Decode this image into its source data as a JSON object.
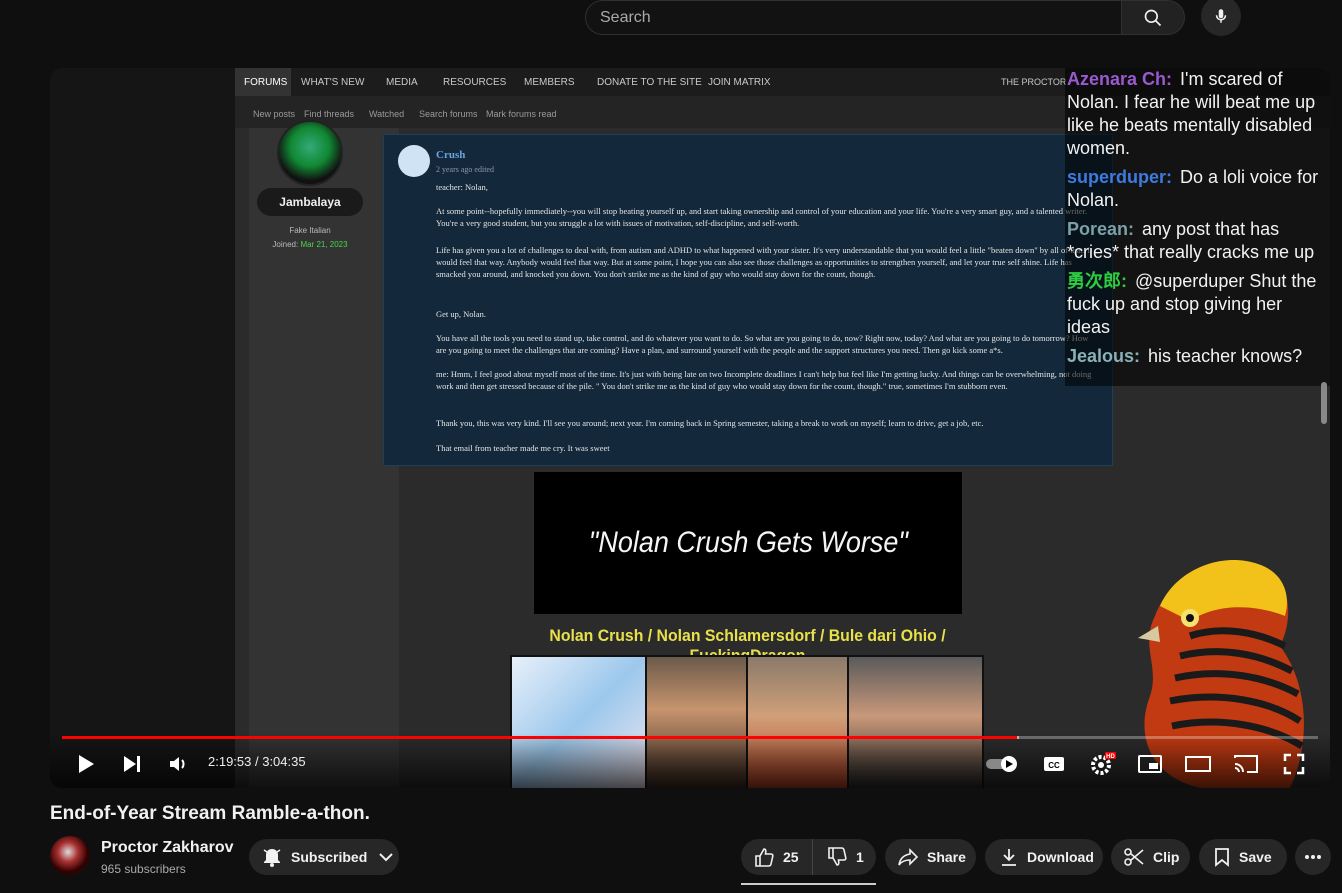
{
  "search": {
    "placeholder": "Search"
  },
  "forum": {
    "nav": [
      "FORUMS",
      "WHAT'S NEW",
      "MEDIA",
      "RESOURCES",
      "MEMBERS",
      "DONATE TO THE SITE",
      "JOIN MATRIX"
    ],
    "user_link": "THE PROCTOR",
    "subnav": [
      "New posts",
      "Find threads",
      "Watched",
      "Search forums",
      "Mark forums read"
    ],
    "sidebar": {
      "name": "Jambalaya",
      "title": "Fake Italian",
      "joined_label": "Joined:",
      "joined_date": "Mar 21, 2023"
    },
    "post": {
      "author": "Crush",
      "meta": "2 years ago     edited",
      "paragraphs": [
        "teacher: Nolan,",
        "At some point--hopefully immediately--you will stop beating yourself up, and start taking ownership and control of your education and your life. You're a very smart guy, and a talented writer. You're a very good student, but you struggle a lot with issues of motivation, self-discipline, and self-worth.",
        "Life has given you a lot of challenges to deal with, from autism and ADHD to what happened with your sister. It's very understandable that you would feel a little \"beaten down\" by all of that. I would feel that way. Anybody would feel that way. But at some point, I hope you can also see those challenges as opportunities to strengthen yourself, and let your true self shine. Life has smacked you around, and knocked you down. You don't strike me as the kind of guy who would stay down for the count, though.",
        "Get up, Nolan.",
        "You have all the tools you need to stand up, take control, and do whatever you want to do. So what are you going to do, now? Right now, today? And what are you going to do tomorrow? How are you going to meet the challenges that are coming? Have a plan, and surround yourself with the people and the support structures you need. Then go kick some a*s.",
        "me: Hmm, I feel good about myself most of the time. It's just with being late on two Incomplete deadlines I can't help but feel like I'm getting lucky. And things can be overwhelming, not doing work and then get stressed because of the pile. \" You don't strike me as the kind of guy who would stay down for the count, though.\" true, sometimes I'm stubborn even.",
        "Thank you, this was very kind. I'll see you around; next year. I'm coming back in Spring semester, taking a break to work on myself; learn to drive, get a job, etc.",
        "That email from teacher made me cry. It was sweet"
      ]
    }
  },
  "overlay": {
    "title": "\"Nolan Crush Gets Worse\"",
    "caption": "Nolan Crush / Nolan Schlamersdorf / Bule dari Ohio / FuckingDragon"
  },
  "chat": [
    {
      "user": "Azenara Ch:",
      "color": "#9b59d0",
      "text": "I'm scared of Nolan. I fear he will beat me up like he beats mentally disabled women."
    },
    {
      "user": "superduper:",
      "color": "#3d7be0",
      "text": "Do a loli voice for Nolan."
    },
    {
      "user": "Porean:",
      "color": "#7aa0a8",
      "text": "any post that has *cries* that really cracks me up"
    },
    {
      "user": "勇次郎:",
      "color": "#2ecc40",
      "text": "@superduper Shut the fuck up and stop giving her ideas"
    },
    {
      "user": "Jealous:",
      "color": "#8ab0b8",
      "text": "his teacher knows?"
    }
  ],
  "player": {
    "time": "2:19:53 / 3:04:35",
    "progress_fraction": 0.76,
    "buffered_fraction": 0.762
  },
  "video": {
    "title": "End-of-Year Stream Ramble-a-thon.",
    "channel": "Proctor Zakharov",
    "subscribers": "965 subscribers",
    "subscribed_label": "Subscribed",
    "likes": "25",
    "dislikes": "1",
    "share_label": "Share",
    "download_label": "Download",
    "clip_label": "Clip",
    "save_label": "Save"
  }
}
